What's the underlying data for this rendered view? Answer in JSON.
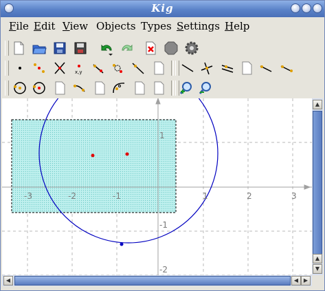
{
  "window": {
    "title": "Kig"
  },
  "menubar": [
    {
      "first": "F",
      "rest": "ile"
    },
    {
      "first": "E",
      "rest": "dit"
    },
    {
      "first": "V",
      "rest": "iew"
    },
    {
      "first": "",
      "rest": "Objects"
    },
    {
      "first": "",
      "rest": "Types"
    },
    {
      "first": "S",
      "rest": "ettings"
    },
    {
      "first": "H",
      "rest": "elp"
    }
  ],
  "canvas": {
    "x_tick_labels": [
      "-3",
      "-2",
      "-1",
      "1",
      "2",
      "3"
    ],
    "y_tick_labels": [
      "1",
      "-1",
      "-2"
    ],
    "colors": {
      "circle": "#0000c0",
      "point": "#e00000",
      "selection_fill": "#bff0ee",
      "grid": "#b8b8b8",
      "axis": "#a0a0a0"
    }
  }
}
